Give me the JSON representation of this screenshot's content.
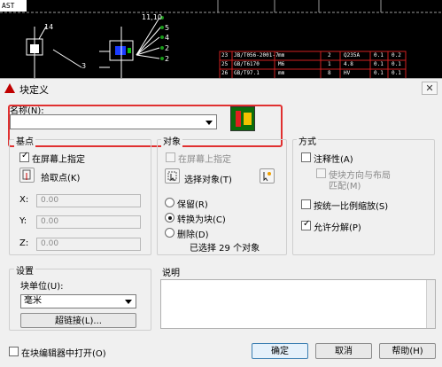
{
  "cad": {
    "tab_label": "AST",
    "callouts": [
      "14",
      "3",
      "11,10",
      "5",
      "4",
      "2",
      "2"
    ],
    "table_rows": [
      [
        "23",
        "JB/T056-2001-7",
        "mm",
        "2",
        "Q235A",
        "0.1",
        "0.2"
      ],
      [
        "25",
        "GB/T6170",
        "M6",
        "1",
        "4.8",
        "0.1",
        "0.1"
      ],
      [
        "26",
        "GB/T97.1",
        "mm",
        "8",
        "HV",
        "0.1",
        "0.1"
      ]
    ]
  },
  "dialog": {
    "title": "块定义",
    "close_label": "✕",
    "name_label": "名称(N):",
    "name_value": ""
  },
  "basepoint": {
    "title": "基点",
    "on_screen_label": "在屏幕上指定",
    "pick_label": "拾取点(K)",
    "x_label": "X:",
    "y_label": "Y:",
    "z_label": "Z:",
    "x_value": "0.00",
    "y_value": "0.00",
    "z_value": "0.00"
  },
  "objects": {
    "title": "对象",
    "on_screen_label": "在屏幕上指定",
    "select_label": "选择对象(T)",
    "retain_label": "保留(R)",
    "convert_label": "转换为块(C)",
    "delete_label": "删除(D)",
    "status_text": "已选择 29 个对象",
    "selected_mode": "convert"
  },
  "behavior": {
    "title": "方式",
    "annotative_label": "注释性(A)",
    "match_label_line1": "使块方向与布局",
    "match_label_line2": "匹配(M)",
    "uniform_label": "按统一比例缩放(S)",
    "explode_label": "允许分解(P)"
  },
  "settings": {
    "title": "设置",
    "unit_label": "块单位(U):",
    "unit_value": "毫米",
    "hyperlink_label": "超链接(L)..."
  },
  "description": {
    "title": "说明"
  },
  "footer": {
    "open_editor_label": "在块编辑器中打开(O)",
    "ok_label": "确定",
    "cancel_label": "取消",
    "help_label": "帮助(H)"
  }
}
